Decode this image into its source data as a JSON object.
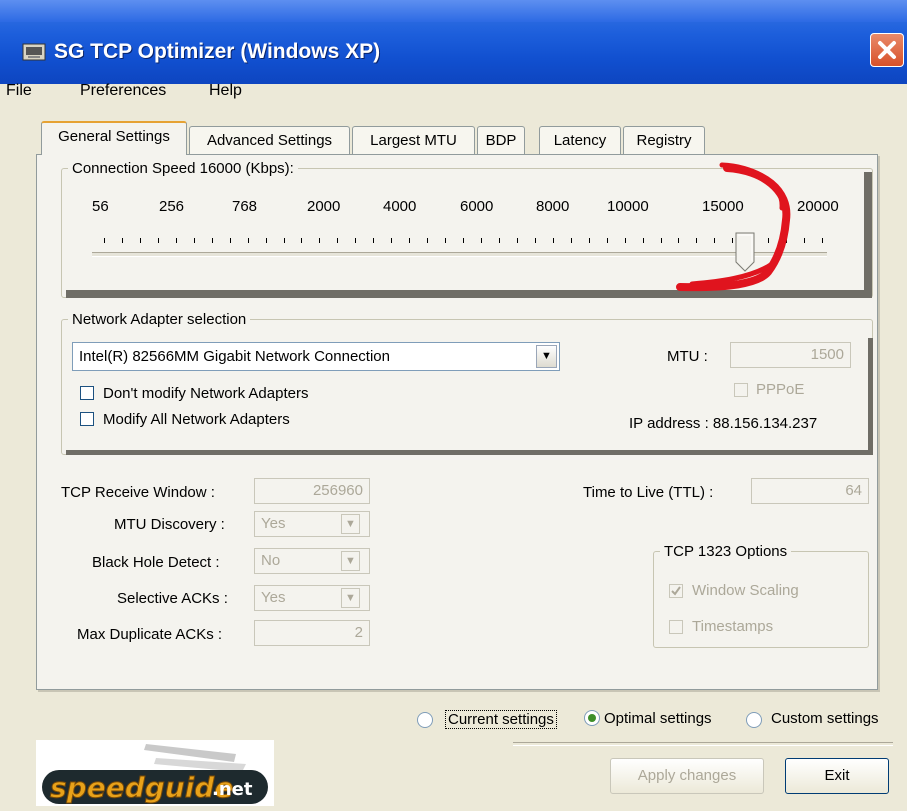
{
  "window": {
    "title": "SG TCP Optimizer (Windows XP)",
    "accent_color": "#1150d0",
    "close_color": "#d8512a"
  },
  "menu": {
    "items": [
      "File",
      "Preferences",
      "Help"
    ]
  },
  "tabs": [
    "General Settings",
    "Advanced Settings",
    "Largest MTU",
    "BDP",
    "Latency",
    "Registry"
  ],
  "connection_speed": {
    "label": "Connection Speed  16000 (Kbps):",
    "scale": [
      "56",
      "256",
      "768",
      "2000",
      "4000",
      "6000",
      "8000",
      "10000",
      "15000",
      "20000"
    ],
    "slider_value_kbps": 16000,
    "annotation_color": "#e0141e"
  },
  "network_adapter": {
    "legend": "Network Adapter selection",
    "selected": "Intel(R) 82566MM Gigabit Network Connection",
    "dont_modify_label": "Don't modify Network Adapters",
    "modify_all_label": "Modify All Network Adapters",
    "mtu_label": "MTU :",
    "mtu_value": "1500",
    "pppoe_label": "PPPoE",
    "ip_label": "IP address : 88.156.134.237"
  },
  "tcp": {
    "receive_window_label": "TCP Receive Window :",
    "receive_window_value": "256960",
    "mtu_discovery_label": "MTU Discovery :",
    "mtu_discovery_value": "Yes",
    "black_hole_label": "Black Hole Detect :",
    "black_hole_value": "No",
    "selective_acks_label": "Selective ACKs :",
    "selective_acks_value": "Yes",
    "max_dup_acks_label": "Max Duplicate ACKs :",
    "max_dup_acks_value": "2",
    "ttl_label": "Time to Live (TTL) :",
    "ttl_value": "64"
  },
  "tcp1323": {
    "legend": "TCP 1323 Options",
    "window_scaling_label": "Window Scaling",
    "window_scaling_checked": true,
    "timestamps_label": "Timestamps",
    "timestamps_checked": false
  },
  "settings_mode": {
    "current_label": "Current settings",
    "optimal_label": "Optimal settings",
    "custom_label": "Custom settings",
    "selected": "Optimal settings"
  },
  "buttons": {
    "apply": "Apply changes",
    "exit": "Exit"
  },
  "logo": {
    "text": "speedguide.net",
    "main": "speedguide",
    "suffix": ".net"
  }
}
